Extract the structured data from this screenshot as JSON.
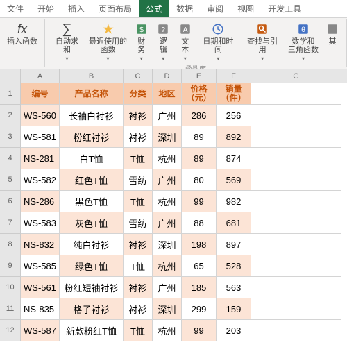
{
  "tabs": [
    "文件",
    "开始",
    "插入",
    "页面布局",
    "公式",
    "数据",
    "审阅",
    "视图",
    "开发工具"
  ],
  "active_tab": 4,
  "ribbon": {
    "insert_fn": "插入函数",
    "autosum": "自动求和",
    "recent": "最近使用的\n函数",
    "financial": "财务",
    "logical": "逻辑",
    "text": "文本",
    "datetime": "日期和时间",
    "lookup": "查找与引用",
    "math": "数学和\n三角函数",
    "more": "其",
    "group_label": "函数库"
  },
  "columns": [
    "A",
    "B",
    "C",
    "D",
    "E",
    "F",
    "G"
  ],
  "headers": {
    "a": "编号",
    "b": "产品名称",
    "c": "分类",
    "d": "地区",
    "e": "价格\n（元）",
    "f": "销量\n（件）"
  },
  "rows": [
    {
      "n": 2,
      "a": "WS-560",
      "b": "长袖白衬衫",
      "c": "衬衫",
      "d": "广州",
      "e": "286",
      "f": "256"
    },
    {
      "n": 3,
      "a": "WS-581",
      "b": "粉红衬衫",
      "c": "衬衫",
      "d": "深圳",
      "e": "89",
      "f": "892"
    },
    {
      "n": 4,
      "a": "NS-281",
      "b": "白T恤",
      "c": "T恤",
      "d": "杭州",
      "e": "89",
      "f": "874"
    },
    {
      "n": 5,
      "a": "WS-582",
      "b": "红色T恤",
      "c": "雪纺",
      "d": "广州",
      "e": "80",
      "f": "569"
    },
    {
      "n": 6,
      "a": "NS-286",
      "b": "黑色T恤",
      "c": "T恤",
      "d": "杭州",
      "e": "99",
      "f": "982"
    },
    {
      "n": 7,
      "a": "WS-583",
      "b": "灰色T恤",
      "c": "雪纺",
      "d": "广州",
      "e": "88",
      "f": "681"
    },
    {
      "n": 8,
      "a": "NS-832",
      "b": "纯白衬衫",
      "c": "衬衫",
      "d": "深圳",
      "e": "198",
      "f": "897"
    },
    {
      "n": 9,
      "a": "WS-585",
      "b": "绿色T恤",
      "c": "T恤",
      "d": "杭州",
      "e": "65",
      "f": "528"
    },
    {
      "n": 10,
      "a": "WS-561",
      "b": "粉红短袖衬衫",
      "c": "衬衫",
      "d": "广州",
      "e": "185",
      "f": "563"
    },
    {
      "n": 11,
      "a": "NS-835",
      "b": "格子衬衫",
      "c": "衬衫",
      "d": "深圳",
      "e": "299",
      "f": "159"
    },
    {
      "n": 12,
      "a": "WS-587",
      "b": "新款粉红T恤",
      "c": "T恤",
      "d": "杭州",
      "e": "99",
      "f": "203"
    }
  ]
}
